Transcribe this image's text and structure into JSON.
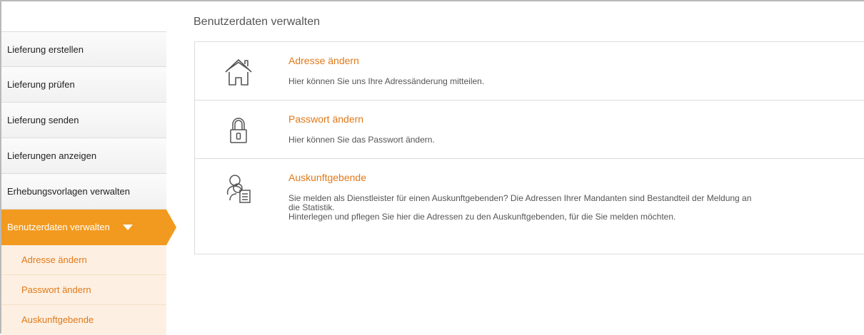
{
  "page": {
    "title": "Benutzerdaten verwalten"
  },
  "sidebar": {
    "items": [
      {
        "label": "Lieferung erstellen"
      },
      {
        "label": "Lieferung prüfen"
      },
      {
        "label": "Lieferung senden"
      },
      {
        "label": "Lieferungen anzeigen"
      },
      {
        "label": "Erhebungsvorlagen verwalten"
      },
      {
        "label": "Benutzerdaten verwalten",
        "active": true
      }
    ],
    "subitems": [
      {
        "label": "Adresse ändern"
      },
      {
        "label": "Passwort ändern"
      },
      {
        "label": "Auskunftgebende"
      }
    ]
  },
  "cards": [
    {
      "icon": "house-icon",
      "title": "Adresse ändern",
      "desc": "Hier können Sie uns Ihre Adressänderung mitteilen."
    },
    {
      "icon": "padlock-icon",
      "title": "Passwort ändern",
      "desc": "Hier können Sie das Passwort ändern."
    },
    {
      "icon": "people-document-icon",
      "title": "Auskunftgebende",
      "desc_line1": "Sie melden als Dienstleister für einen Auskunftgebenden? Die Adressen Ihrer Mandanten sind Bestandteil der Meldung an die Statistik.",
      "desc_line2": "Hinterlegen und pflegen Sie hier die Adressen zu den Auskunftgebenden, für die Sie melden möchten."
    }
  ],
  "colors": {
    "accent": "#f29a1f",
    "link": "#e0791a",
    "subnav_bg": "#fdf0e2"
  }
}
